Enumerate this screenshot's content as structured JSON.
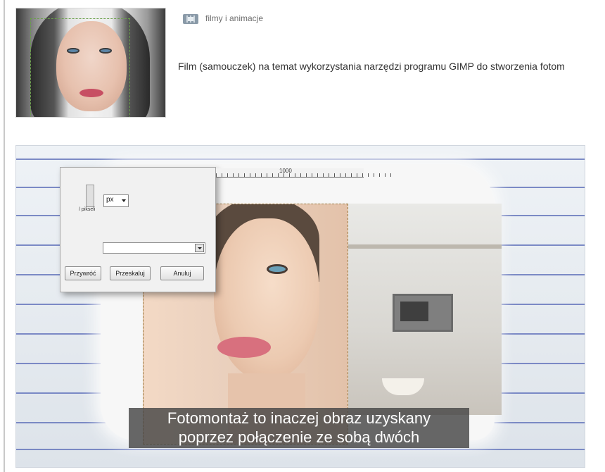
{
  "item": {
    "category": "filmy i animacje",
    "category_icon": "film-strip-icon",
    "description": "Film (samouczek) na temat wykorzystania narzędzi programu GIMP do stworzenia fotom"
  },
  "video": {
    "ruler_label": "1000",
    "dialog": {
      "unit": "px",
      "unit_label": "/ pikseli",
      "buttons": {
        "reset": "Przywróć",
        "scale": "Przeskaluj",
        "cancel": "Anuluj"
      }
    },
    "subtitle": {
      "line1": "Fotomontaż to inaczej obraz uzyskany",
      "line2": "poprzez połączenie ze sobą dwóch"
    }
  }
}
